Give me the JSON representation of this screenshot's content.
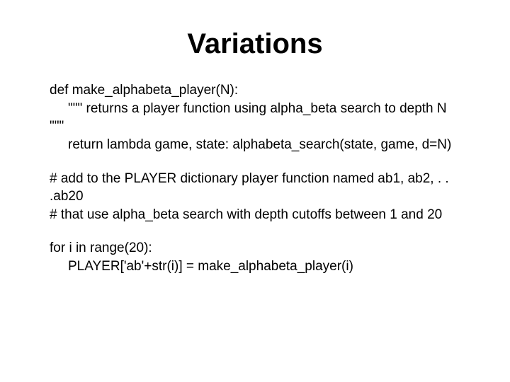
{
  "title": "Variations",
  "code": {
    "def_line": "def make_alphabeta_player(N):",
    "docstring_open": "\"\"\" returns a player function using alpha_beta search to depth N",
    "docstring_close": "\"\"\"",
    "return_line": "return lambda game, state: alphabeta_search(state, game, d=N)"
  },
  "comments": {
    "c1": "# add to the PLAYER dictionary player function named ab1, ab2, . . .ab20",
    "c2": "# that use alpha_beta search with depth cutoffs between 1 and 20"
  },
  "loop": {
    "for_line": "for i in range(20):",
    "body_line": "PLAYER['ab'+str(i)] = make_alphabeta_player(i)"
  }
}
